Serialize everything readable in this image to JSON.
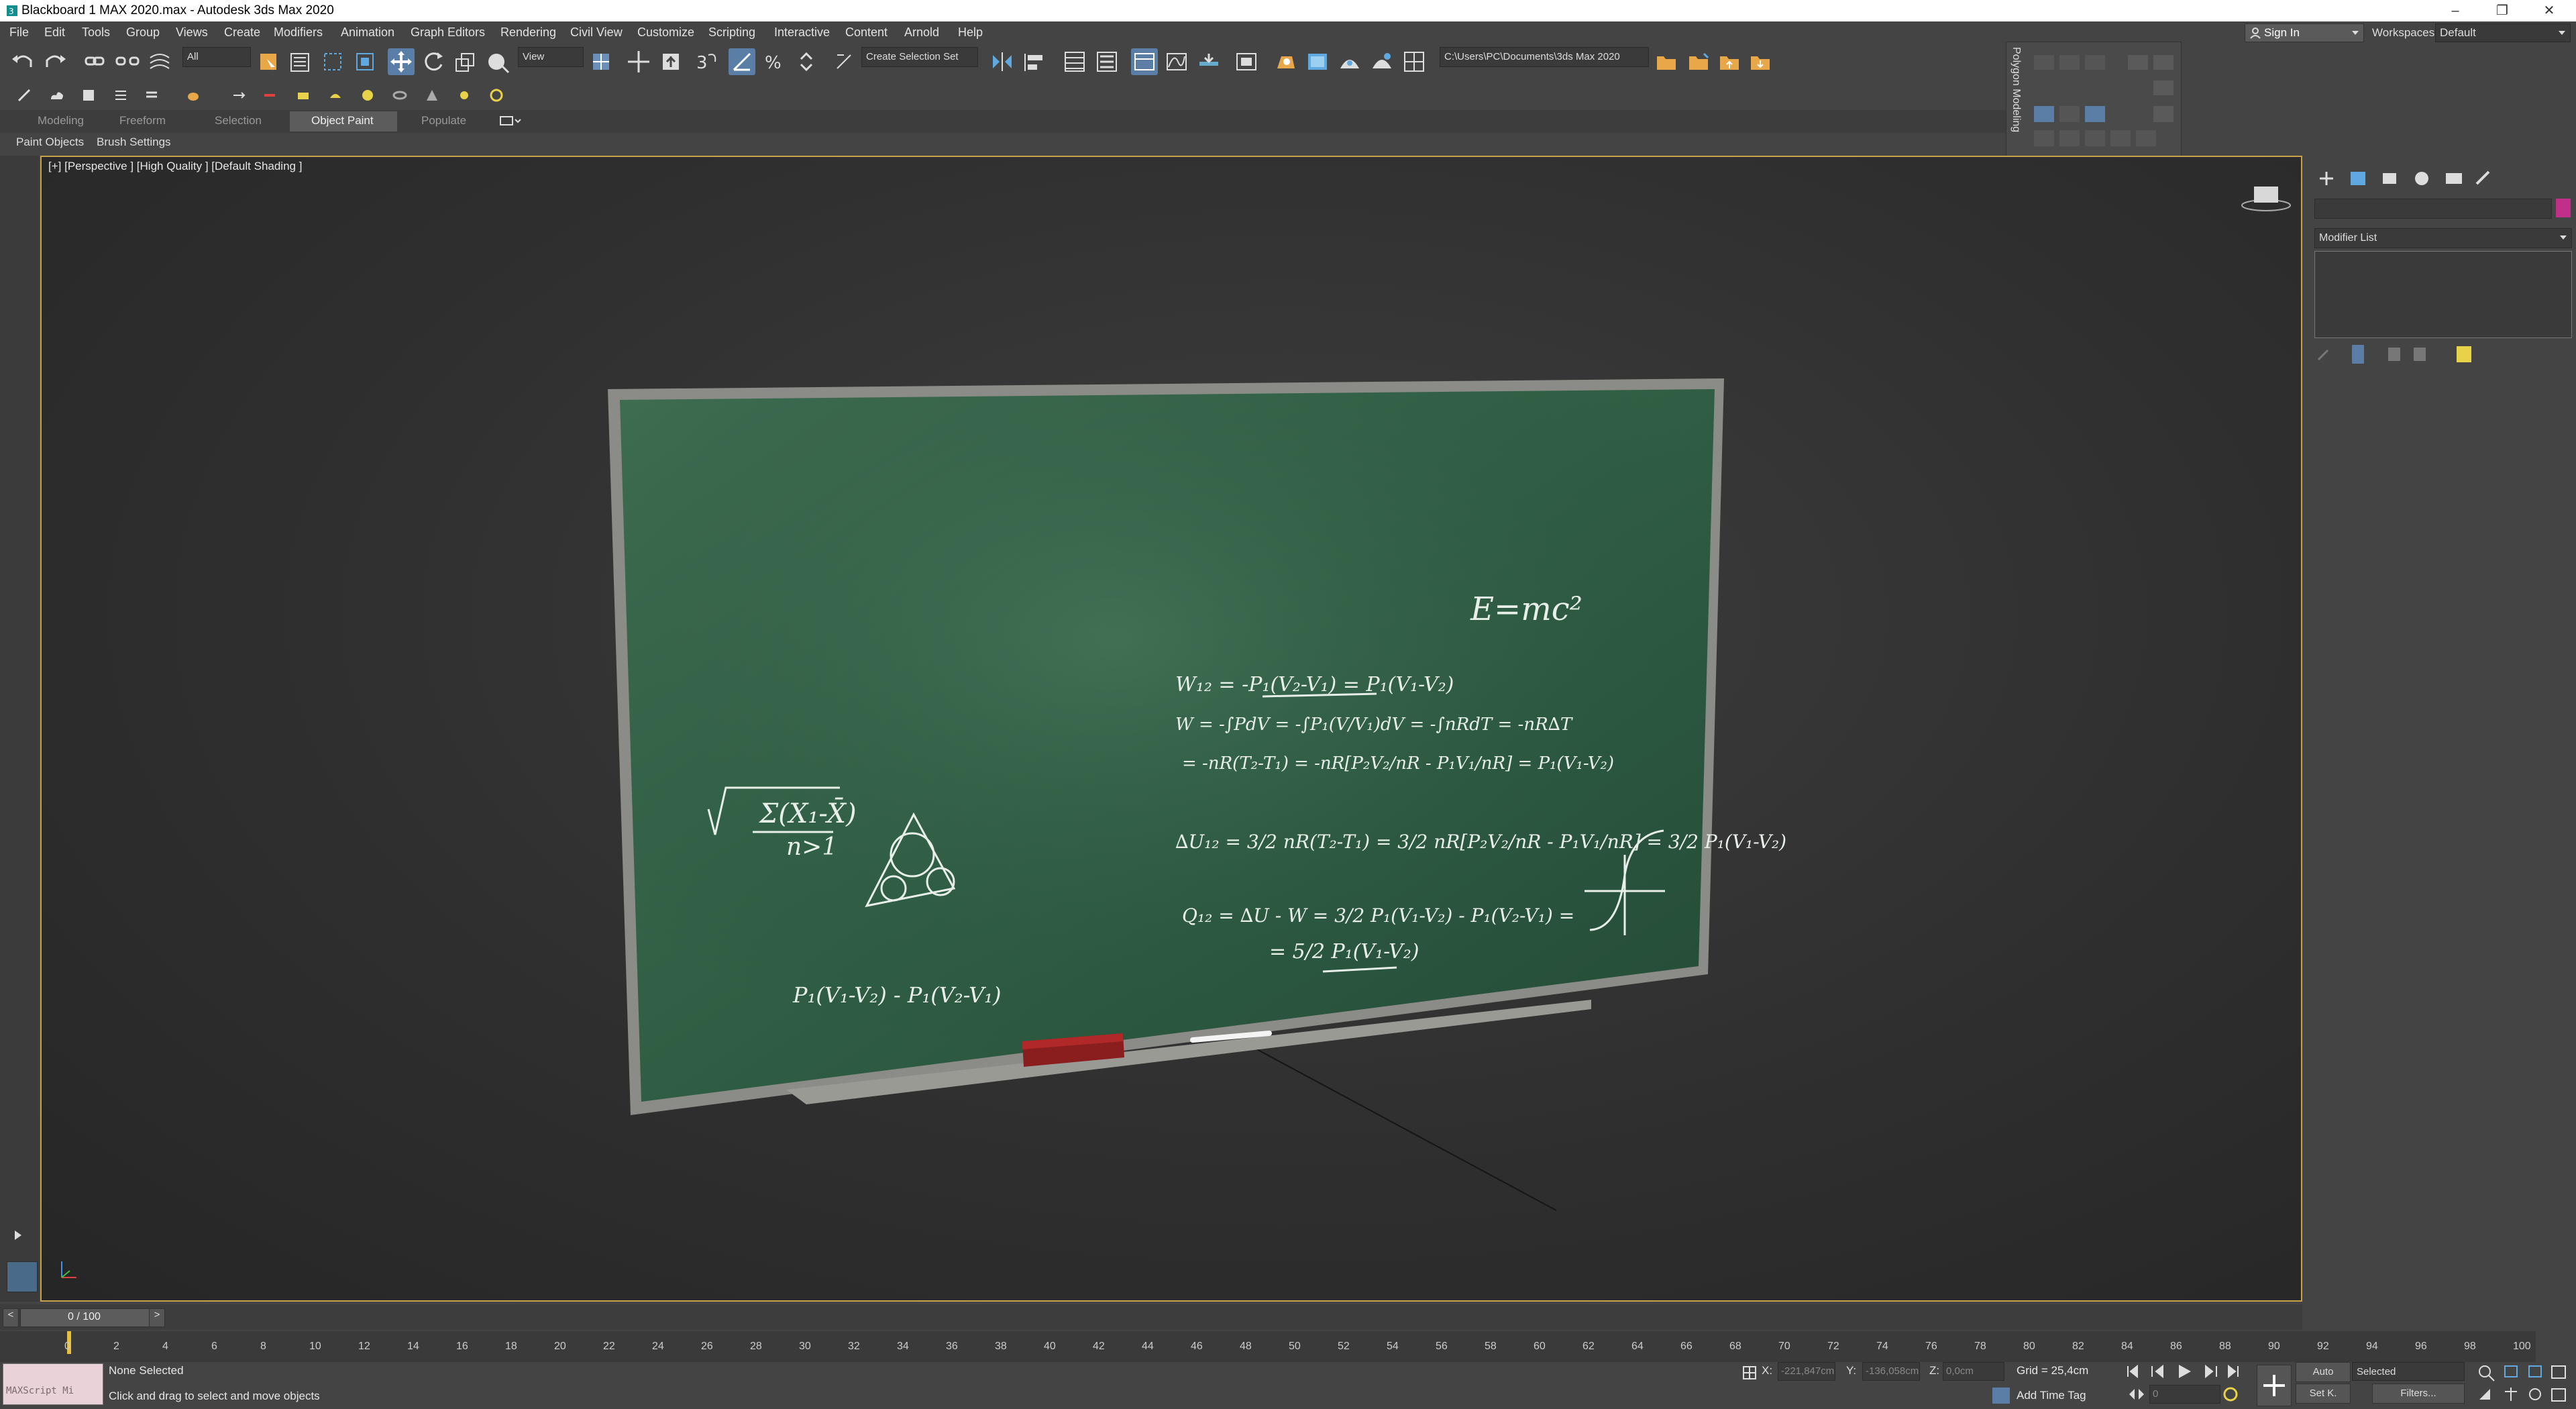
{
  "window": {
    "title": "Blackboard 1 MAX 2020.max - Autodesk 3ds Max 2020",
    "controls": {
      "minimize": "–",
      "restore": "❐",
      "close": "✕"
    }
  },
  "menu": [
    "File",
    "Edit",
    "Tools",
    "Group",
    "Views",
    "Create",
    "Modifiers",
    "Animation",
    "Graph Editors",
    "Rendering",
    "Civil View",
    "Customize",
    "Scripting",
    "Interactive",
    "Content",
    "Arnold",
    "Help"
  ],
  "account": {
    "signin": "Sign In",
    "workspaces_label": "Workspaces:",
    "workspace": "Default"
  },
  "toolbar": {
    "selection_filter": "All",
    "reference_coord": "View",
    "selection_set_placeholder": "Create Selection Set",
    "project_path": "C:\\Users\\PC\\Documents\\3ds Max 2020"
  },
  "ribbon": {
    "tabs": [
      "Modeling",
      "Freeform",
      "Selection",
      "Object Paint",
      "Populate"
    ],
    "active_tab": "Object Paint",
    "subtabs": [
      "Paint Objects",
      "Brush Settings"
    ]
  },
  "floating_panel": {
    "title": "Polygon Modeling"
  },
  "viewport": {
    "label": "[+] [Perspective ] [High Quality ] [Default Shading ]",
    "chalk": {
      "equation1": "E=mc²",
      "line1": "W₁₂ = -P₁(V₂-V₁) = P₁(V₁-V₂)",
      "line2": "W = -∫PdV = -∫P₁(V/V₁)dV = -∫nRdT = -nR∆T",
      "line3": "= -nR(T₂-T₁) = -nR[P₂V₂/nR - P₁V₁/nR] = P₁(V₁-V₂)",
      "line4": "∆U₁₂ = 3/2 nR(T₂-T₁) = 3/2 nR[P₂V₂/nR - P₁V₁/nR] = 3/2 P₁(V₁-V₂)",
      "line5": "Q₁₂ = ∆U - W = 3/2 P₁(V₁-V₂) - P₁(V₂-V₁) =",
      "line6": "= 5/2 P₁(V₁-V₂)",
      "sqrt_numerator": "Σ(X₁-X̄)",
      "sqrt_denominator": "n>1",
      "bottom_left": "P₁(V₁-V₂) - P₁(V₂-V₁)"
    }
  },
  "command_panel": {
    "modifier_list": "Modifier List",
    "color": "#c0308a"
  },
  "timeline": {
    "frame_display": "0 / 100",
    "ticks": [
      "0",
      "2",
      "4",
      "6",
      "8",
      "10",
      "12",
      "14",
      "16",
      "18",
      "20",
      "22",
      "24",
      "26",
      "28",
      "30",
      "32",
      "34",
      "36",
      "38",
      "40",
      "42",
      "44",
      "46",
      "48",
      "50",
      "52",
      "54",
      "56",
      "58",
      "60",
      "62",
      "64",
      "66",
      "68",
      "70",
      "72",
      "74",
      "76",
      "78",
      "80",
      "82",
      "84",
      "86",
      "88",
      "90",
      "92",
      "94",
      "96",
      "98",
      "100"
    ]
  },
  "status": {
    "maxscript": "MAXScript Mi",
    "selection": "None Selected",
    "prompt": "Click and drag to select and move objects",
    "x_label": "X:",
    "x_value": "-221,847cm",
    "y_label": "Y:",
    "y_value": "-136,058cm",
    "z_label": "Z:",
    "z_value": "0,0cm",
    "grid": "Grid = 25,4cm",
    "add_time_tag": "Add Time Tag",
    "auto": "Auto",
    "set_key": "Set K.",
    "key_filter": "Selected",
    "filters": "Filters...",
    "current_frame": "0"
  }
}
